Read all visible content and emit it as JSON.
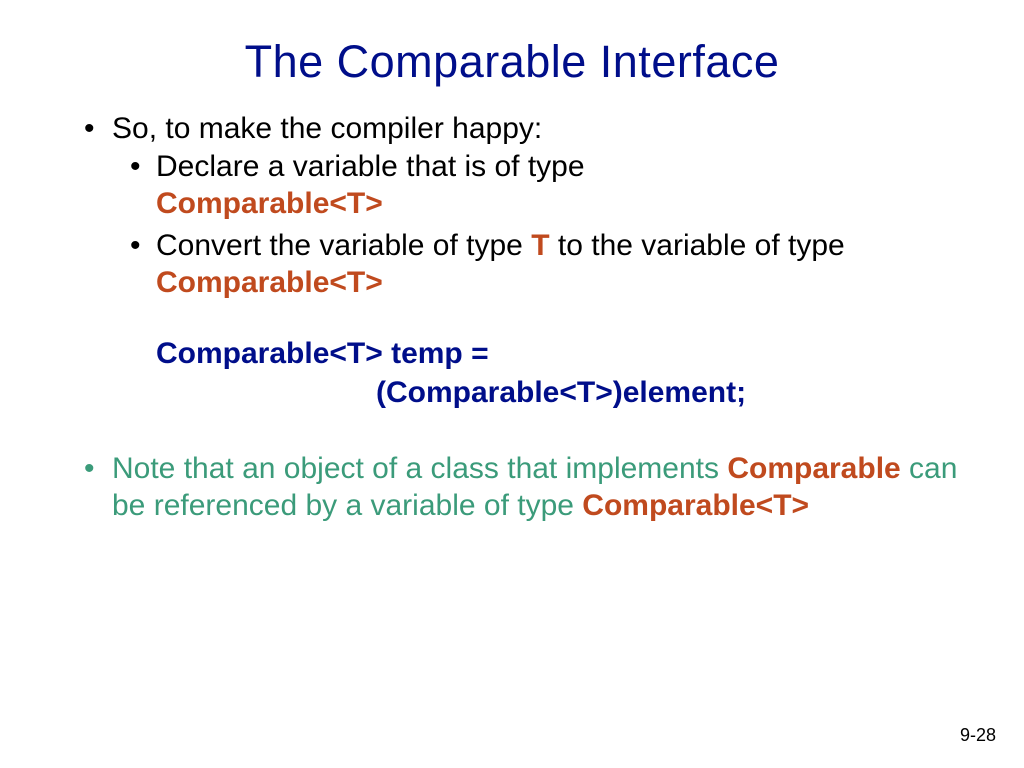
{
  "title": "The Comparable Interface",
  "bullets": {
    "top1": "So, to make the compiler happy:",
    "sub1_pre": "Declare a variable that is of type ",
    "sub1_code": "Comparable<T>",
    "sub2_a": "Convert the variable of type ",
    "sub2_t": "T",
    "sub2_b": " to the variable of type ",
    "sub2_code": "Comparable<T>",
    "code_line1": "Comparable<T> temp =",
    "code_line2": "(Comparable<T>)element;",
    "note_a": "Note that an object of a class that implements ",
    "note_comp": "Comparable",
    "note_b": " can be referenced by a variable of type ",
    "note_code": "Comparable<T>"
  },
  "page": "9-28"
}
